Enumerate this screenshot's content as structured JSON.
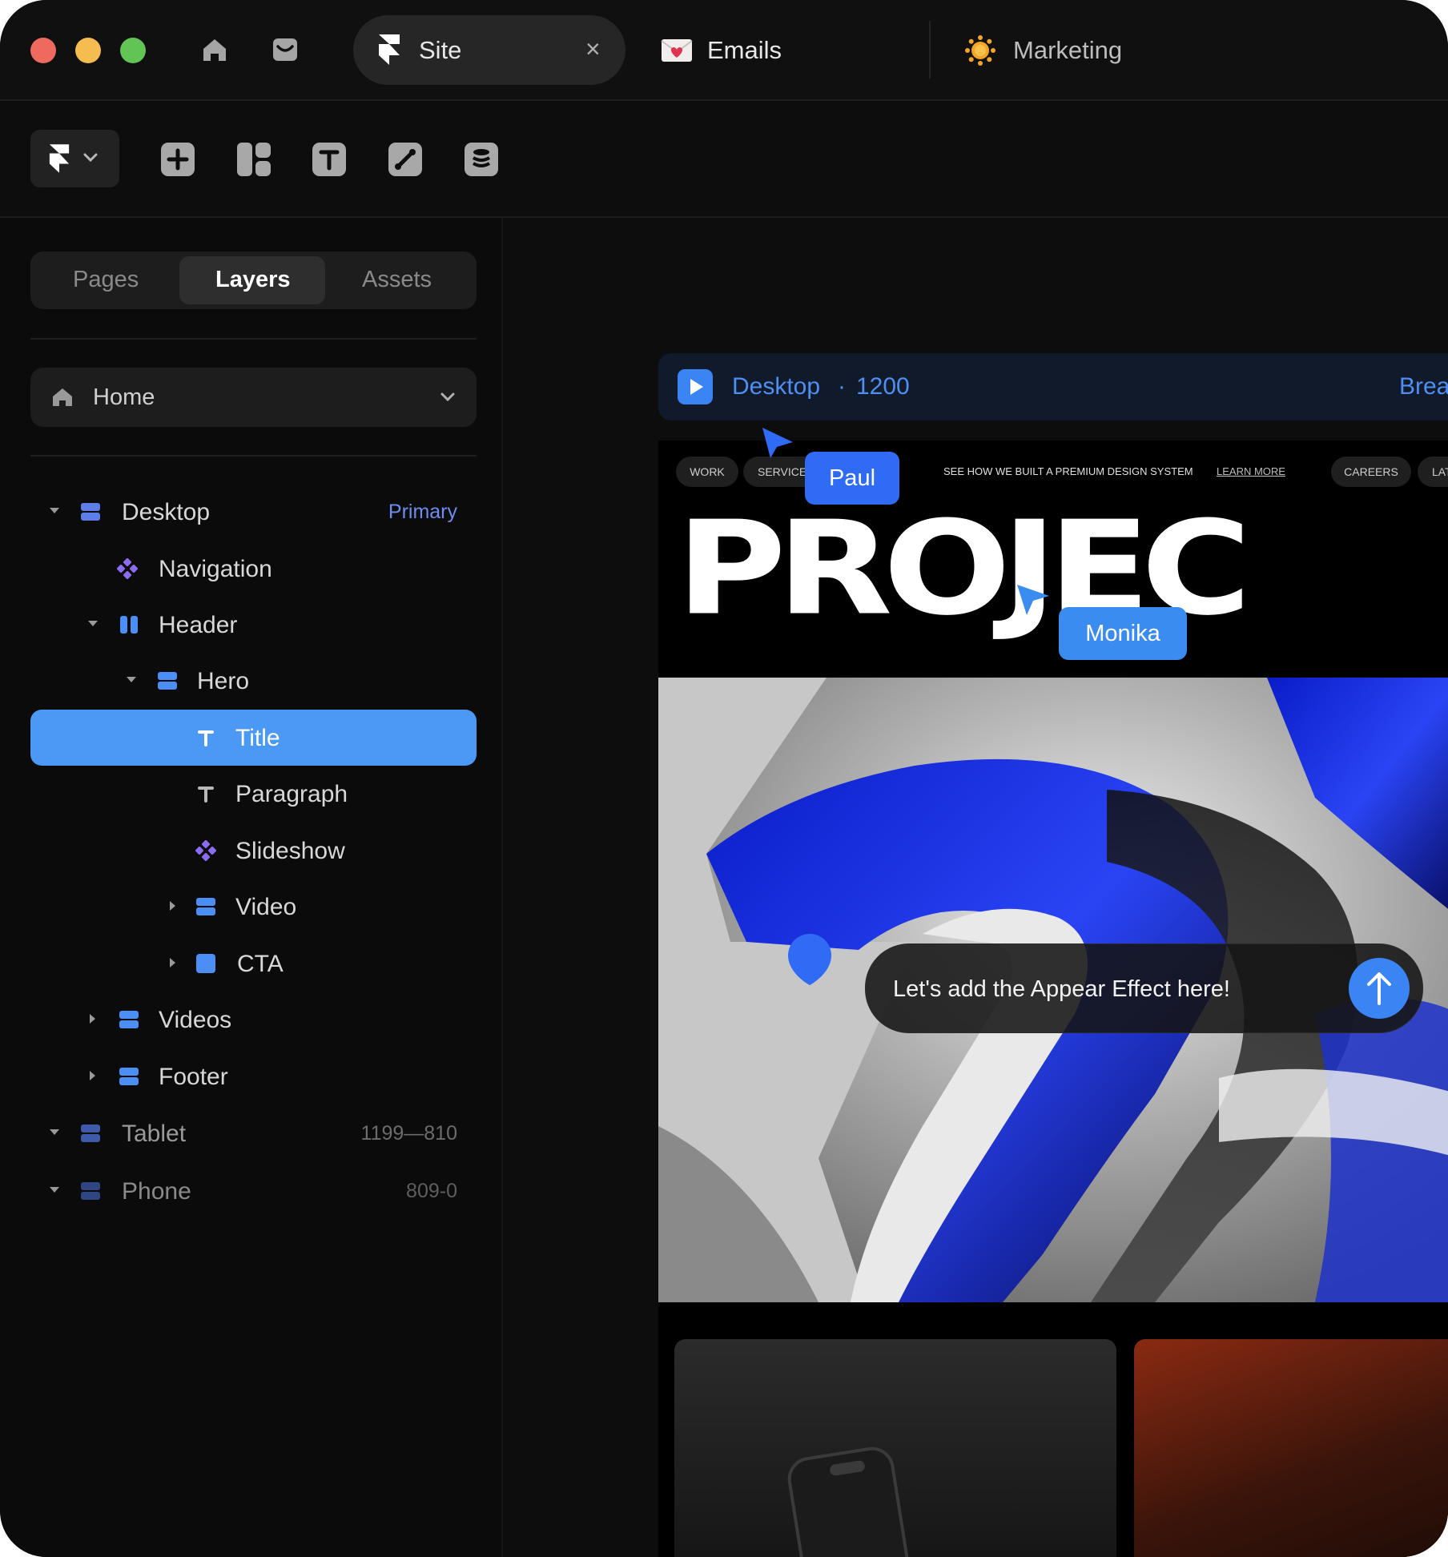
{
  "titlebar": {
    "tabs": [
      {
        "label": "Site",
        "active": true,
        "icon": "framer-logo-icon"
      },
      {
        "label": "Emails",
        "active": false,
        "icon": "envelope-heart-icon"
      },
      {
        "label": "Marketing",
        "active": false,
        "icon": "sun-icon"
      }
    ],
    "close_glyph": "×"
  },
  "toolbar": {
    "tools": [
      "insert-icon",
      "layout-icon",
      "text-icon",
      "vector-icon",
      "cms-icon"
    ]
  },
  "sidebar": {
    "segments": [
      "Pages",
      "Layers",
      "Assets"
    ],
    "active_segment": "Layers",
    "page_select": {
      "value": "Home"
    },
    "layers": [
      {
        "label": "Desktop",
        "meta": "Primary"
      },
      {
        "label": "Navigation"
      },
      {
        "label": "Header"
      },
      {
        "label": "Hero"
      },
      {
        "label": "Title",
        "selected": true
      },
      {
        "label": "Paragraph"
      },
      {
        "label": "Slideshow"
      },
      {
        "label": "Video"
      },
      {
        "label": "CTA"
      },
      {
        "label": "Videos"
      },
      {
        "label": "Footer"
      },
      {
        "label": "Tablet",
        "meta": "1199—810"
      },
      {
        "label": "Phone",
        "meta": "809-0"
      }
    ]
  },
  "canvas": {
    "frame_bar": {
      "name": "Desktop",
      "dot": "·",
      "width": "1200",
      "right_label": "Brea"
    },
    "site": {
      "nav": {
        "work": "WORK",
        "service": "SERVICE",
        "announcement": "SEE HOW WE BUILT A PREMIUM DESIGN SYSTEM",
        "learn_more": "LEARN MORE",
        "careers": "CAREERS",
        "lat": "LAT"
      },
      "title": "PROJEC"
    },
    "cursors": [
      {
        "name": "Paul",
        "color": "#2f6bf4"
      },
      {
        "name": "Monika",
        "color": "#3a8cf0"
      }
    ],
    "comment": {
      "text": "Let's add the Appear Effect here!"
    }
  },
  "colors": {
    "accent": "#4b98f5",
    "window_bg": "#0b0b0b",
    "cursor_blue": "#2f6bf4",
    "purple_component": "#8b6cf0"
  }
}
